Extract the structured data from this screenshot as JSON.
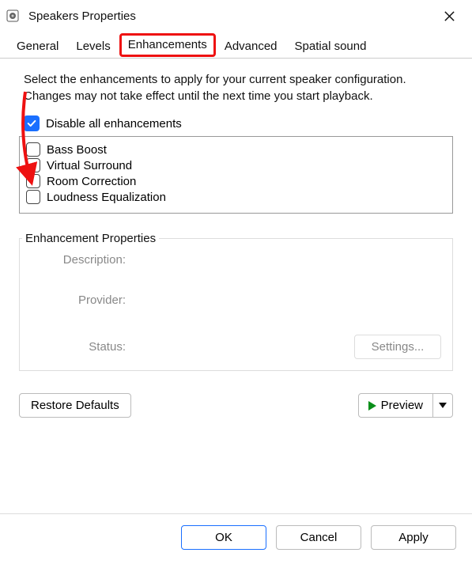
{
  "window": {
    "title": "Speakers Properties"
  },
  "tabs": [
    {
      "label": "General"
    },
    {
      "label": "Levels"
    },
    {
      "label": "Enhancements",
      "highlight": true
    },
    {
      "label": "Advanced"
    },
    {
      "label": "Spatial sound"
    }
  ],
  "intro": "Select the enhancements to apply for your current speaker configuration. Changes may not take effect until the next time you start playback.",
  "disable_all": {
    "label": "Disable all enhancements",
    "checked": true
  },
  "enhancements": [
    {
      "label": "Bass Boost",
      "checked": false
    },
    {
      "label": "Virtual Surround",
      "checked": false
    },
    {
      "label": "Room Correction",
      "checked": false
    },
    {
      "label": "Loudness Equalization",
      "checked": false
    }
  ],
  "props": {
    "group_label": "Enhancement Properties",
    "keys": {
      "description": "Description:",
      "provider": "Provider:",
      "status": "Status:"
    },
    "values": {
      "description": "",
      "provider": "",
      "status": ""
    },
    "settings_label": "Settings..."
  },
  "buttons": {
    "restore": "Restore Defaults",
    "preview": "Preview",
    "ok": "OK",
    "cancel": "Cancel",
    "apply": "Apply"
  },
  "annotation": {
    "color": "#e11"
  }
}
